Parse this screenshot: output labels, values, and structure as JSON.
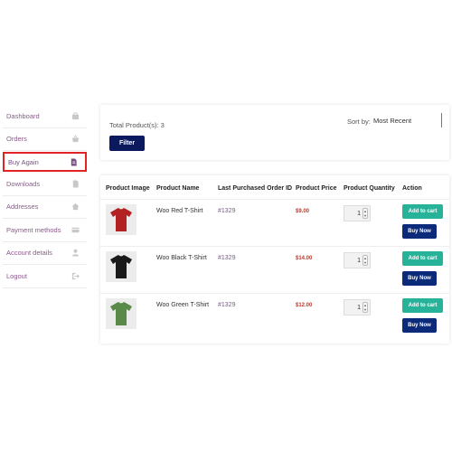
{
  "sidebar": {
    "items": [
      {
        "label": "Dashboard",
        "icon": "dashboard-icon"
      },
      {
        "label": "Orders",
        "icon": "basket-icon"
      },
      {
        "label": "Buy Again",
        "icon": "document-icon",
        "active": true
      },
      {
        "label": "Downloads",
        "icon": "file-download-icon"
      },
      {
        "label": "Addresses",
        "icon": "home-icon"
      },
      {
        "label": "Payment methods",
        "icon": "credit-card-icon"
      },
      {
        "label": "Account details",
        "icon": "user-icon"
      },
      {
        "label": "Logout",
        "icon": "logout-icon"
      }
    ],
    "active_highlight_color": "#e02424"
  },
  "filter": {
    "total_products": "Total Product(s): 3",
    "sort_label": "Sort by:",
    "sort_value": "Most Recent",
    "filter_button": "Filter"
  },
  "table": {
    "headers": {
      "image": "Product Image",
      "name": "Product Name",
      "order": "Last Purchased Order ID",
      "price": "Product Price",
      "quantity": "Product Quantity",
      "action": "Action"
    },
    "rows": [
      {
        "name": "Woo Red T-Shirt",
        "order_id": "#1329",
        "price": "$9.00",
        "quantity": "1",
        "shirt_color": "#b22222",
        "add_to_cart": "Add to cart",
        "buy_now": "Buy Now"
      },
      {
        "name": "Woo Black T-Shirt",
        "order_id": "#1329",
        "price": "$14.00",
        "quantity": "1",
        "shirt_color": "#1a1a1a",
        "add_to_cart": "Add to cart",
        "buy_now": "Buy Now"
      },
      {
        "name": "Woo Green T-Shirt",
        "order_id": "#1329",
        "price": "$12.00",
        "quantity": "1",
        "shirt_color": "#5a8a4a",
        "add_to_cart": "Add to cart",
        "buy_now": "Buy Now"
      }
    ]
  },
  "colors": {
    "filter_button": "#0b1a5e",
    "add_to_cart": "#26b39a",
    "buy_now": "#0b2a7a",
    "price": "#c0392b",
    "nav_link": "#8a5a8a"
  }
}
